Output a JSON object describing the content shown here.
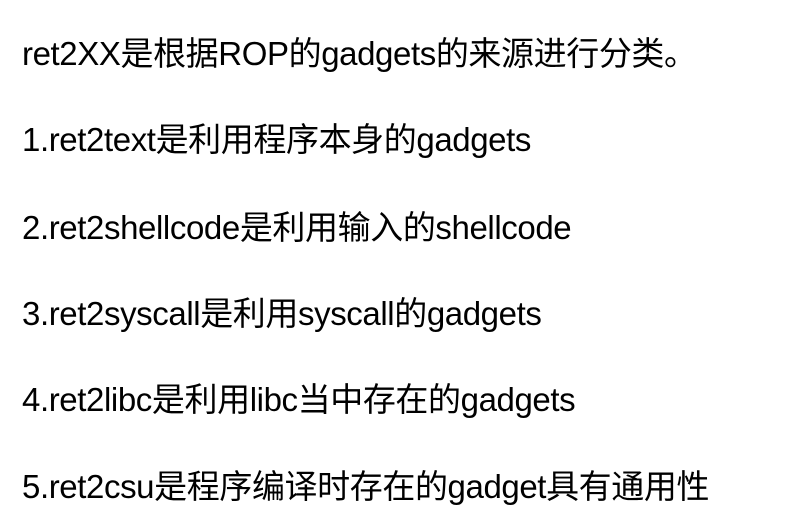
{
  "document": {
    "lines": [
      "ret2XX是根据ROP的gadgets的来源进行分类。",
      "1.ret2text是利用程序本身的gadgets",
      "2.ret2shellcode是利用输入的shellcode",
      "3.ret2syscall是利用syscall的gadgets",
      "4.ret2libc是利用libc当中存在的gadgets",
      "5.ret2csu是程序编译时存在的gadget具有通用性"
    ]
  },
  "colors": {
    "background": "#ffffff",
    "text": "#000000"
  }
}
